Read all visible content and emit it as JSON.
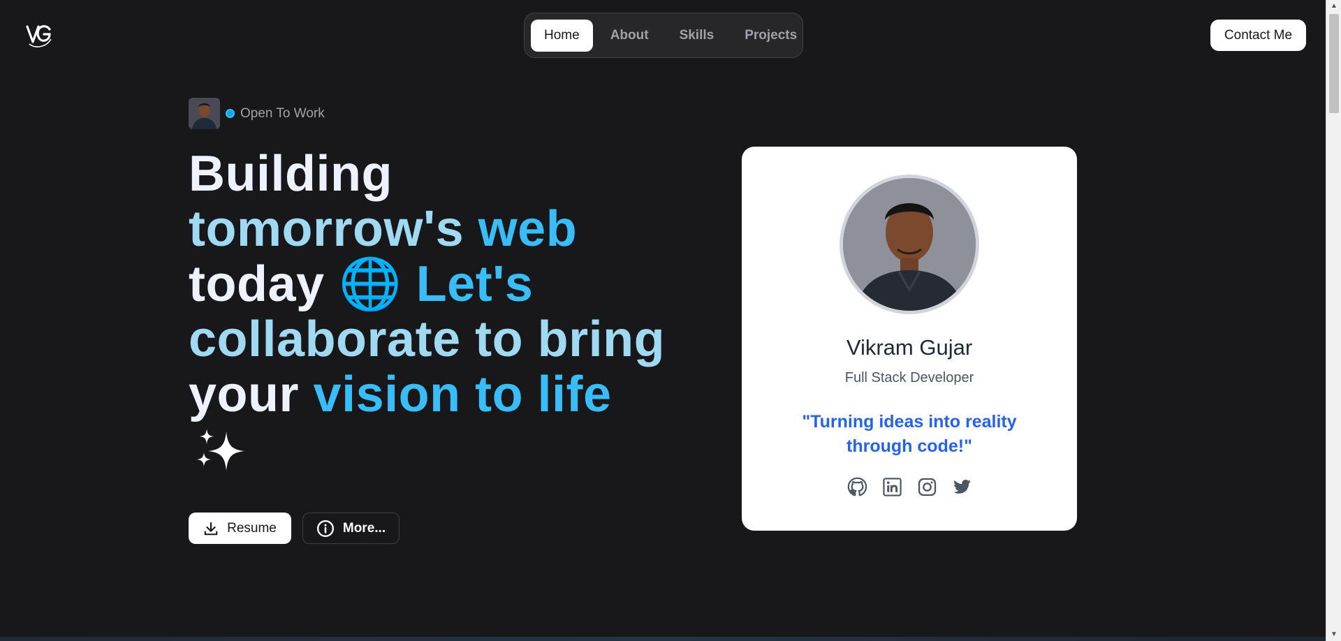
{
  "header": {
    "logo_text": "VG",
    "nav": [
      "Home",
      "About",
      "Skills",
      "Projects"
    ],
    "active_nav": "Home",
    "contact_label": "Contact Me"
  },
  "hero": {
    "status": "Open To Work",
    "headline_lines": [
      [
        "Building"
      ],
      [
        "tomorrow's",
        " web"
      ],
      [
        "today ",
        "🌐",
        " Let's"
      ],
      [
        "collaborate to bring"
      ],
      [
        "your ",
        "vision to life"
      ],
      [
        "✨"
      ]
    ],
    "resume_label": "Resume",
    "more_label": "More..."
  },
  "card": {
    "name": "Vikram Gujar",
    "role": "Full Stack Developer",
    "quote": "\"Turning ideas into reality through code!\"",
    "socials": [
      "github-icon",
      "linkedin-icon",
      "instagram-icon",
      "twitter-icon"
    ]
  },
  "colors": {
    "background": "#18181b",
    "accent": "#38bdf8",
    "quote": "#2563eb"
  }
}
